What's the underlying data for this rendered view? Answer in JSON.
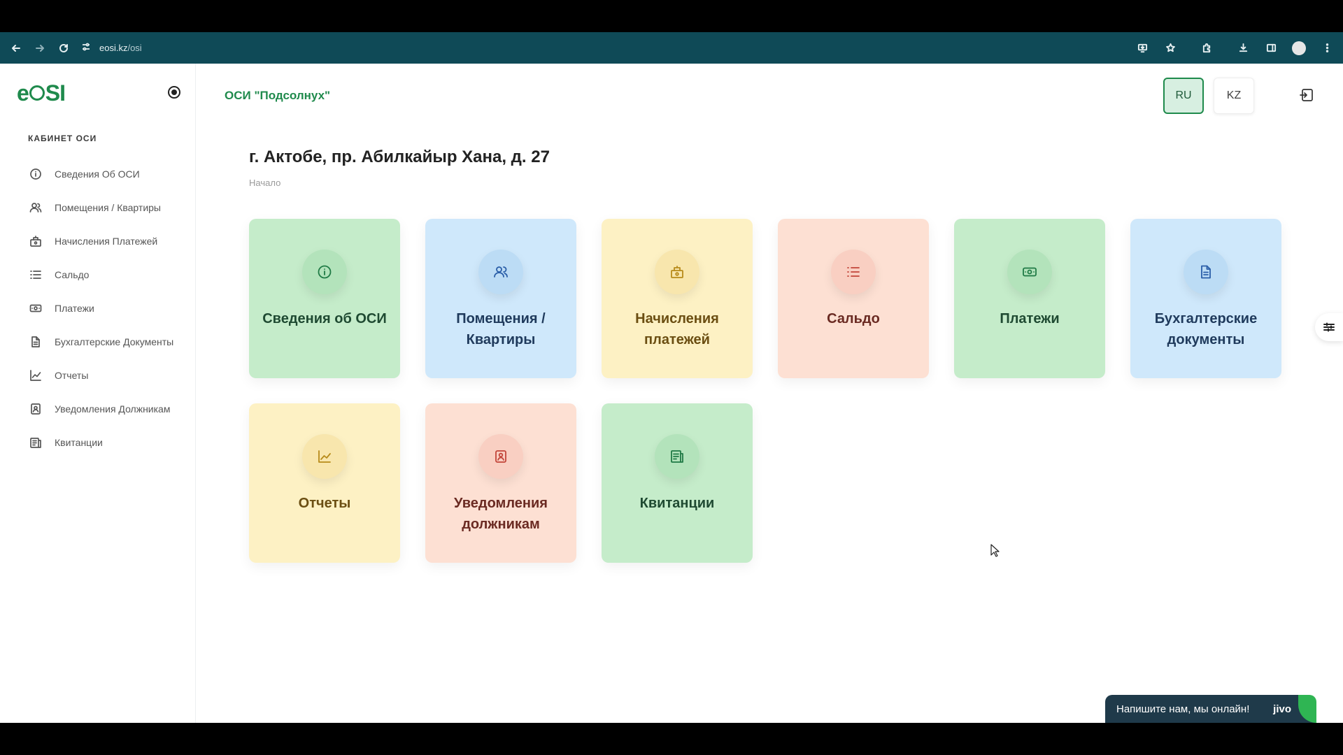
{
  "browser": {
    "url_host": "eosi.kz",
    "url_path": "/osi"
  },
  "sidebar": {
    "logo": "eOSI",
    "section_title": "КАБИНЕТ ОСИ",
    "items": [
      {
        "label": "Сведения Об ОСИ",
        "icon": "info-icon"
      },
      {
        "label": "Помещения / Квартиры",
        "icon": "users-icon"
      },
      {
        "label": "Начисления Платежей",
        "icon": "cash-register-icon"
      },
      {
        "label": "Сальдо",
        "icon": "list-icon"
      },
      {
        "label": "Платежи",
        "icon": "banknote-icon"
      },
      {
        "label": "Бухгалтерские Документы",
        "icon": "document-icon"
      },
      {
        "label": "Отчеты",
        "icon": "chart-icon"
      },
      {
        "label": "Уведомления Должникам",
        "icon": "contact-badge-icon"
      },
      {
        "label": "Квитанции",
        "icon": "receipt-icon"
      }
    ]
  },
  "header": {
    "osi_name": "ОСИ \"Подсолнух\"",
    "lang_ru": "RU",
    "lang_kz": "KZ",
    "active_lang": "RU"
  },
  "main": {
    "address": "г. Актобе, пр. Абилкайыр Хана, д. 27",
    "breadcrumb": "Начало",
    "cards": [
      {
        "label": "Сведения об ОСИ",
        "color": "#c5ecca",
        "icon": "info-icon"
      },
      {
        "label": "Помещения / Квартиры",
        "color": "#cfe8fb",
        "icon": "users-icon"
      },
      {
        "label": "Начисления платежей",
        "color": "#fdf1c4",
        "icon": "cash-register-icon"
      },
      {
        "label": "Сальдо",
        "color": "#fde0d3",
        "icon": "list-icon"
      },
      {
        "label": "Платежи",
        "color": "#c5ecca",
        "icon": "banknote-icon"
      },
      {
        "label": "Бухгалтерские документы",
        "color": "#cfe8fb",
        "icon": "document-icon"
      },
      {
        "label": "Отчеты",
        "color": "#fdf1c4",
        "icon": "chart-icon"
      },
      {
        "label": "Уведомления должникам",
        "color": "#fde0d3",
        "icon": "contact-badge-icon"
      },
      {
        "label": "Квитанции",
        "color": "#c5ecca",
        "icon": "receipt-icon"
      }
    ]
  },
  "chat": {
    "text": "Напишите нам, мы онлайн!",
    "brand": "jivo"
  },
  "colors": {
    "brand_green": "#1f8a4c",
    "browser_bar": "#0f4a57",
    "chat_bg": "#1f3a4a"
  }
}
